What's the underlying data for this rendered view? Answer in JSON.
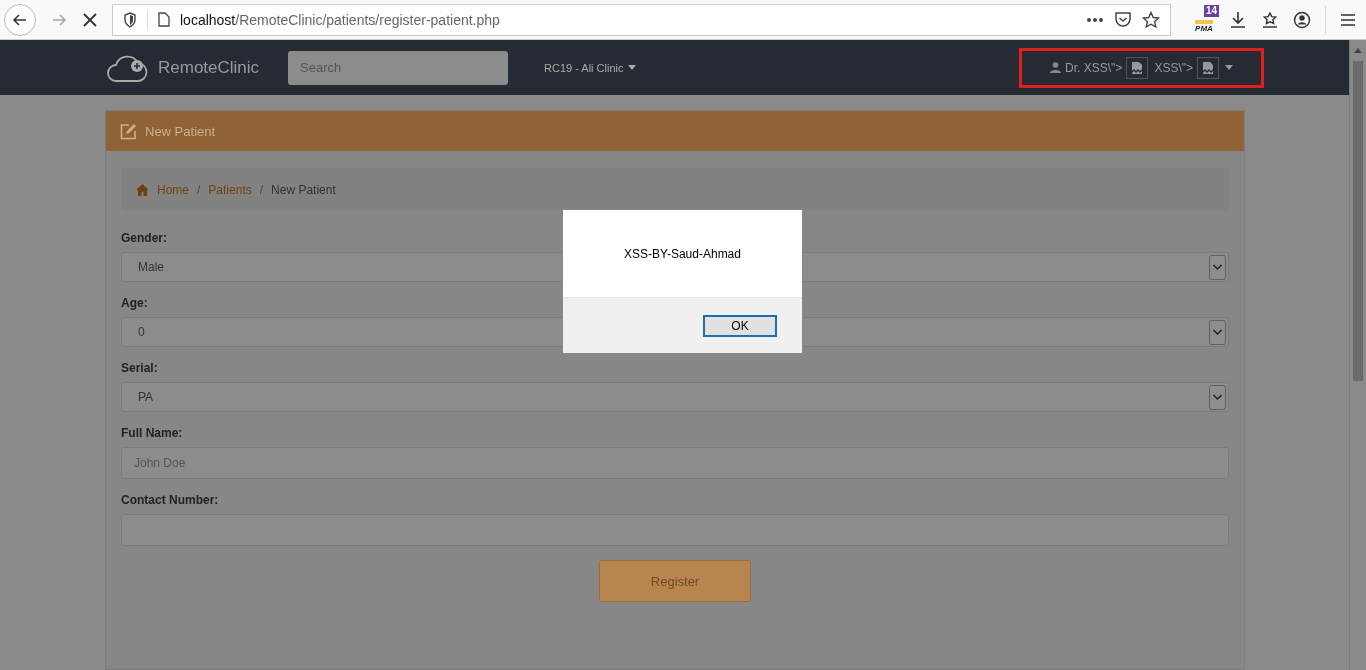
{
  "browser": {
    "url_host": "localhost",
    "url_path": "/RemoteClinic/patients/register-patient.php",
    "extension_badge": "14",
    "extension_label": "PMA"
  },
  "navbar": {
    "brand": "RemoteClinic",
    "search": {
      "placeholder": "Search"
    },
    "clinic": "RC19 - Ali Clinic",
    "user_parts": [
      "Dr. XSS\\\">",
      "XSS\\\">"
    ],
    "highlighted": true
  },
  "panel": {
    "title": "New Patient"
  },
  "breadcrumb_separator": "/",
  "breadcrumb": [
    {
      "label": "Home",
      "kind": "home"
    },
    {
      "label": "Patients",
      "kind": "link"
    },
    {
      "label": "New Patient",
      "kind": "current"
    }
  ],
  "fields": [
    {
      "label": "Gender:",
      "kind": "select",
      "value": "Male"
    },
    {
      "label": "Age:",
      "kind": "select",
      "value": "0"
    },
    {
      "label": "Serial:",
      "kind": "select",
      "value": "PA"
    },
    {
      "label": "Full Name:",
      "kind": "input",
      "placeholder": "John Doe"
    },
    {
      "label": "Contact Number:",
      "kind": "input"
    }
  ],
  "register_button": "Register",
  "dialog": {
    "message": "XSS-BY-Saud-Ahmad",
    "button": "OK"
  }
}
